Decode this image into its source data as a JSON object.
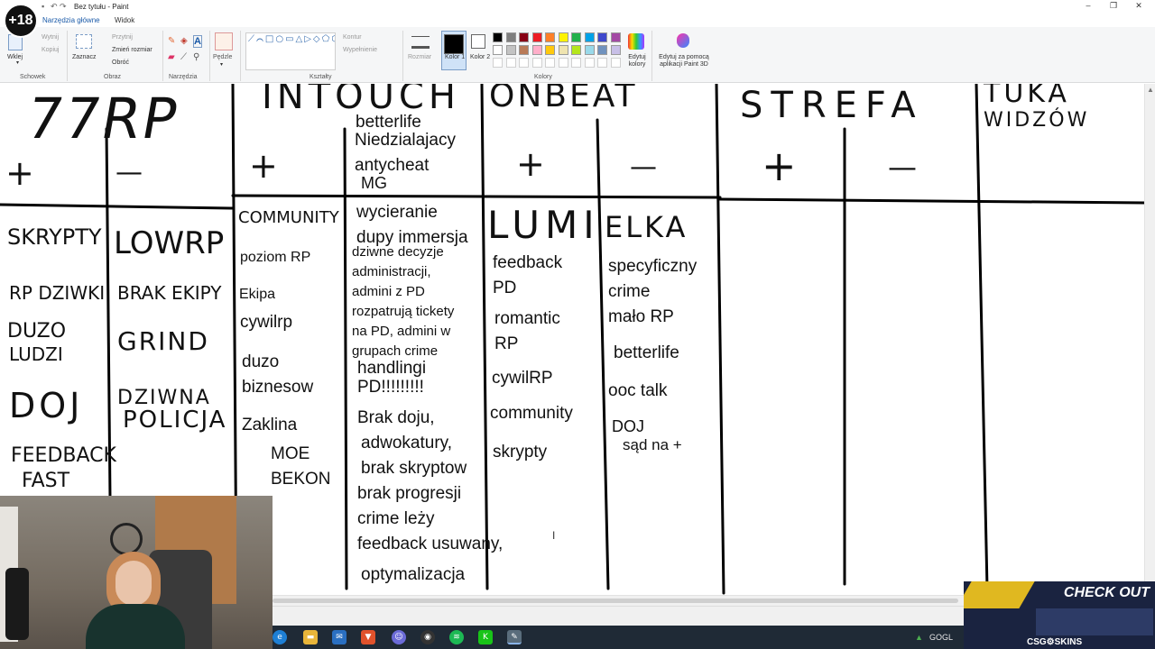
{
  "window": {
    "title": "Bez tytułu - Paint",
    "badge": "+18"
  },
  "tabs": [
    "Narzędzia główne",
    "Widok"
  ],
  "ribbon": {
    "clipboard": {
      "paste": "Wklej",
      "cut": "Wytnij",
      "copy": "Kopiuj",
      "label": "Schowek"
    },
    "image": {
      "select": "Zaznacz",
      "crop": "Przytnij",
      "resize": "Zmień rozmiar",
      "rotate": "Obróć",
      "label": "Obraz"
    },
    "tools": {
      "label": "Narzędzia"
    },
    "brushes": {
      "label": "Pędzle"
    },
    "shapes": {
      "outline": "Kontur",
      "fill": "Wypełnienie",
      "label": "Kształty"
    },
    "size": {
      "label": "Rozmiar"
    },
    "color1": "Kolor 1",
    "color2": "Kolor 2",
    "colors_label": "Kolory",
    "edit_colors": "Edytuj kolory",
    "paint3d": "Edytuj za pomocą aplikacji Paint 3D",
    "palette": [
      "#000000",
      "#7f7f7f",
      "#880015",
      "#ed1c24",
      "#ff7f27",
      "#fff200",
      "#22b14c",
      "#00a2e8",
      "#3f48cc",
      "#a349a4",
      "#ffffff",
      "#c3c3c3",
      "#b97a57",
      "#ffaec9",
      "#ffc90e",
      "#efe4b0",
      "#b5e61d",
      "#99d9ea",
      "#7092be",
      "#c8bfe7"
    ]
  },
  "canvas": {
    "headers": {
      "rp77": "77RP",
      "intouch": "INTOUCH",
      "onbeat": "ONBEAT",
      "strefa": "STREFA",
      "tuka_line1": "TUKA",
      "tuka_line2": "WIDZÓW"
    },
    "plus": "+",
    "minus": "—",
    "rp77_plus": [
      "SKRYPTY",
      "RP DZIWKI",
      "DUZO",
      "LUDZI",
      "DOJ",
      "FEEDBACK",
      "FAST"
    ],
    "rp77_minus": [
      "LOWRP",
      "BRAK EKIPY",
      "GRIND",
      "DZIWNA",
      "POLICJA"
    ],
    "intouch_extra": [
      "betterlife",
      "Niedzialajacy",
      "antycheat",
      "MG"
    ],
    "intouch_plus": [
      "COMMUNITY",
      "poziom RP",
      "Ekipa",
      "cywilrp",
      "duzo",
      "biznesow",
      "Zaklina",
      "MOE",
      "BEKON"
    ],
    "intouch_minus_top": [
      "wycieranie",
      "dupy immersja"
    ],
    "intouch_minus_block": [
      "dziwne decyzje",
      "administracji,",
      "admini z PD",
      "rozpatrują tickety",
      "na PD, admini w",
      "grupach crime"
    ],
    "intouch_minus_bottom": [
      "handlingi",
      "PD!!!!!!!!!",
      "Brak doju,",
      "adwokatury,",
      "brak skryptow",
      "brak progresji",
      "crime leży",
      "feedback usuwany,",
      "optymalizacja"
    ],
    "onbeat_plus": [
      "LUMI",
      "feedback",
      "PD",
      "romantic",
      "RP",
      "cywilRP",
      "community",
      "skrypty"
    ],
    "onbeat_minus": [
      "ELKA",
      "specyficzny",
      "crime",
      "mało RP",
      "betterlife",
      "ooc talk",
      "DOJ",
      "sąd na +"
    ]
  },
  "taskbar": {
    "tray_label": "GOGL"
  },
  "ad": {
    "headline": "CHECK OUT",
    "brand": "CSG⚙SKINS"
  }
}
